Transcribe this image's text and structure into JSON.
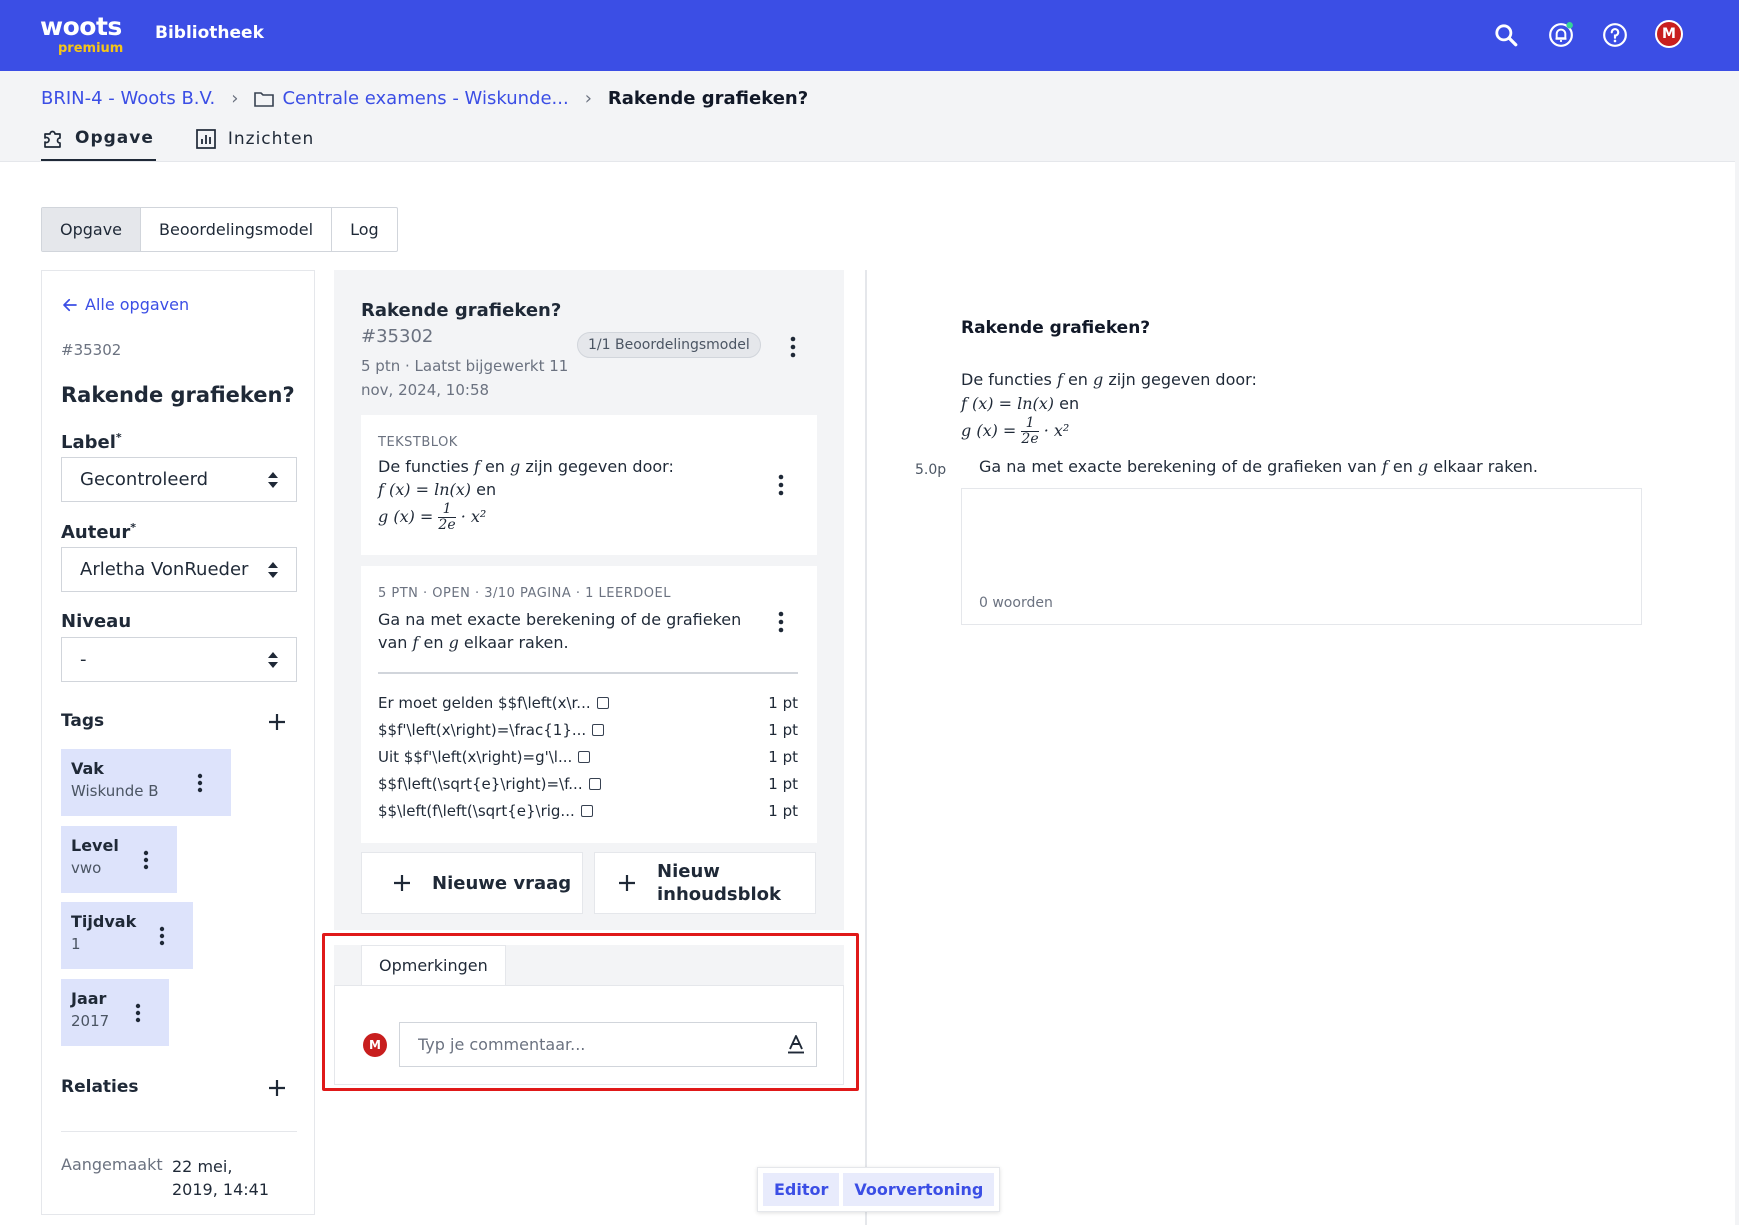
{
  "header": {
    "logo_main": "woots",
    "logo_sub": "premium",
    "app_title": "Bibliotheek",
    "notification_dot_color": "#34d399"
  },
  "breadcrumb": {
    "org": "BRIN-4 - Woots B.V.",
    "folder": "Centrale examens - Wiskunde...",
    "current": "Rakende grafieken?"
  },
  "top_tabs": {
    "opgave": "Opgave",
    "inzichten": "Inzichten"
  },
  "segments": {
    "opgave": "Opgave",
    "beoordelingsmodel": "Beoordelingsmodel",
    "log": "Log"
  },
  "left": {
    "back": "Alle opgaven",
    "id": "#35302",
    "title": "Rakende grafieken?",
    "label_heading": "Label",
    "label_value": "Gecontroleerd",
    "auteur_heading": "Auteur",
    "auteur_value": "Arletha VonRueder",
    "niveau_heading": "Niveau",
    "niveau_value": "-",
    "required_mark": "*",
    "tags_heading": "Tags",
    "tags": [
      {
        "key": "Vak",
        "value": "Wiskunde B"
      },
      {
        "key": "Level",
        "value": "vwo"
      },
      {
        "key": "Tijdvak",
        "value": "1"
      },
      {
        "key": "Jaar",
        "value": "2017"
      }
    ],
    "relaties_heading": "Relaties",
    "created_label": "Aangemaakt",
    "created_value": "22 mei, 2019, 14:41"
  },
  "middle": {
    "title": "Rakende grafieken?",
    "id": "#35302",
    "meta": "5 ptn · Laatst bijgewerkt 11 nov, 2024, 10:58",
    "pill": "1/1 Beoordelingsmodel",
    "textblock": {
      "kicker": "TEKSTBLOK",
      "intro_before": "De functies ",
      "f": "f",
      "en": " en ",
      "g": "g",
      "intro_after": " zijn gegeven door:",
      "f_def": "f (x) = ln(x)",
      "f_def_suffix": " en",
      "g_def_lhs": "g (x) =",
      "g_frac_num": "1",
      "g_frac_den": "2e",
      "g_def_rhs": "· x²"
    },
    "question": {
      "kicker": "5 PTN · OPEN · 3/10 PAGINA · 1 LEERDOEL",
      "text_before": "Ga na met exacte berekening of de grafieken van ",
      "f": "f",
      "en": " en ",
      "g": "g",
      "text_after": " elkaar raken."
    },
    "criteria": [
      {
        "text": "Er moet gelden $$f\\left(x\\r...",
        "points": "1 pt"
      },
      {
        "text": "$$f'\\left(x\\right)=\\frac{1}...",
        "points": "1 pt"
      },
      {
        "text": "Uit $$f'\\left(x\\right)=g'\\l...",
        "points": "1 pt"
      },
      {
        "text": "$$f\\left(\\sqrt{e}\\right)=\\f...",
        "points": "1 pt"
      },
      {
        "text": "$$\\left(f\\left(\\sqrt{e}\\rig...",
        "points": "1 pt"
      }
    ],
    "new_question": "Nieuwe vraag",
    "new_block": "Nieuw inhoudsblok"
  },
  "comments": {
    "tab": "Opmerkingen",
    "avatar": "M",
    "placeholder": "Typ je commentaar..."
  },
  "preview": {
    "title": "Rakende grafieken?",
    "intro_before": "De functies ",
    "f": "f",
    "en": " en ",
    "g": "g",
    "intro_after": " zijn gegeven door:",
    "f_def": "f (x) = ln(x)",
    "f_def_suffix": " en",
    "g_def_lhs": "g (x) =",
    "g_frac_num": "1",
    "g_frac_den": "2e",
    "g_def_rhs": "· x²",
    "points": "5.0p",
    "q_before": "Ga na met exacte berekening of de grafieken van ",
    "q_after": " elkaar raken.",
    "words": "0 woorden"
  },
  "user_avatar": "M",
  "view_toggle": {
    "editor": "Editor",
    "preview": "Voorvertoning"
  }
}
